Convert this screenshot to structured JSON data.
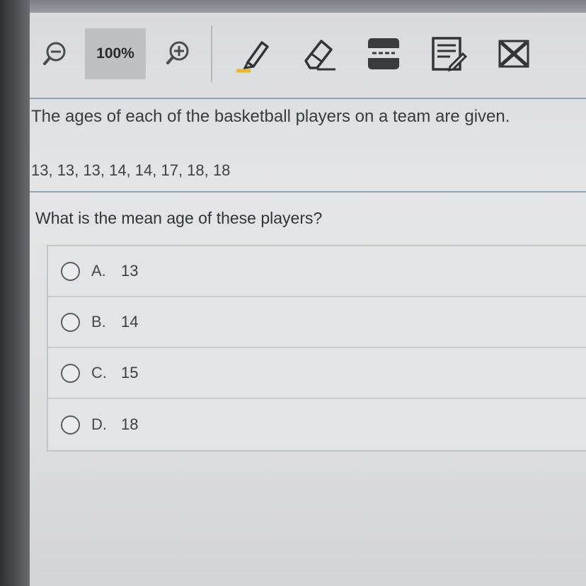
{
  "toolbar": {
    "zoom_level": "100%",
    "icons": [
      "zoom-out-icon",
      "zoom-in-icon",
      "highlighter-icon",
      "eraser-icon",
      "line-reader-icon",
      "notepad-icon",
      "answer-eliminator-icon"
    ]
  },
  "passage": {
    "text": "The ages of each of the basketball players on a team are given.",
    "data": "13, 13, 13, 14, 14, 17, 18, 18"
  },
  "question": {
    "text": "What is the mean age of these players?"
  },
  "choices": [
    {
      "letter": "A.",
      "value": "13"
    },
    {
      "letter": "B.",
      "value": "14"
    },
    {
      "letter": "C.",
      "value": "15"
    },
    {
      "letter": "D.",
      "value": "18"
    }
  ],
  "colors": {
    "divider_blue": "#8fa3b6",
    "zoom_bg": "#bfc0c3"
  }
}
